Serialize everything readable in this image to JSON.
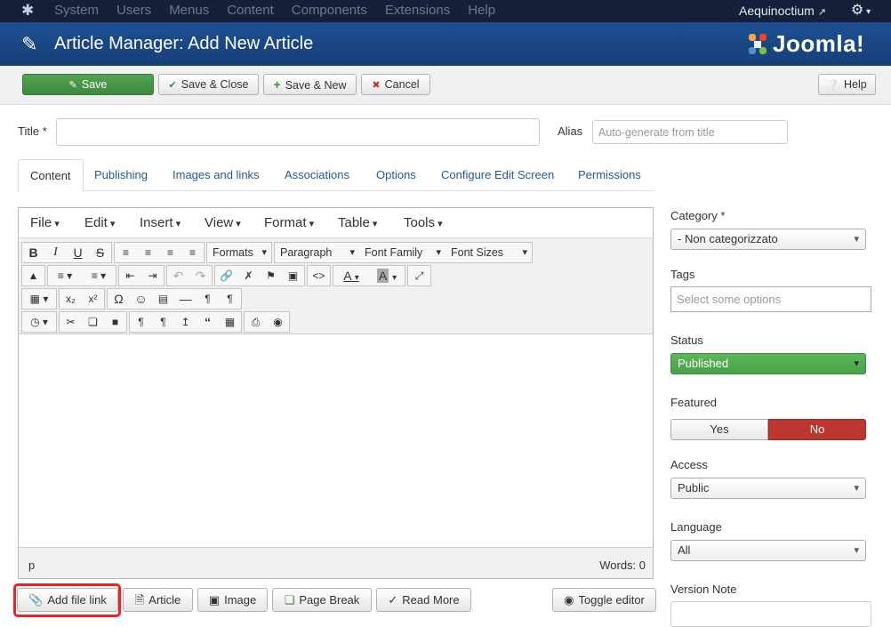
{
  "navbar": {
    "menu": [
      "System",
      "Users",
      "Menus",
      "Content",
      "Components",
      "Extensions",
      "Help"
    ],
    "user": "Aequinoctium"
  },
  "header": {
    "title": "Article Manager: Add New Article",
    "logo_text": "Joomla!"
  },
  "toolbar": {
    "save": "Save",
    "save_close": "Save & Close",
    "save_new": "Save & New",
    "cancel": "Cancel",
    "help": "Help"
  },
  "form": {
    "title_label": "Title *",
    "title_value": "",
    "alias_label": "Alias",
    "alias_placeholder": "Auto-generate from title"
  },
  "tabs": [
    "Content",
    "Publishing",
    "Images and links",
    "Associations",
    "Options",
    "Configure Edit Screen",
    "Permissions"
  ],
  "editor": {
    "menus": [
      "File",
      "Edit",
      "Insert",
      "View",
      "Format",
      "Table",
      "Tools"
    ],
    "formats": "Formats",
    "paragraph": "Paragraph",
    "font_family": "Font Family",
    "font_sizes": "Font Sizes",
    "path": "p",
    "words": "Words: 0"
  },
  "editor_buttons": {
    "add_file_link": "Add file link",
    "article": "Article",
    "image": "Image",
    "page_break": "Page Break",
    "read_more": "Read More",
    "toggle": "Toggle editor"
  },
  "sidebar": {
    "category_label": "Category *",
    "category_value": "- Non categorizzato",
    "tags_label": "Tags",
    "tags_placeholder": "Select some options",
    "status_label": "Status",
    "status_value": "Published",
    "featured_label": "Featured",
    "featured_yes": "Yes",
    "featured_no": "No",
    "access_label": "Access",
    "access_value": "Public",
    "language_label": "Language",
    "language_value": "All",
    "version_label": "Version Note"
  },
  "colors": {
    "navbar": "#17203a",
    "header": "#1d5093",
    "save_green": "#51a351",
    "no_red": "#bd362f"
  }
}
